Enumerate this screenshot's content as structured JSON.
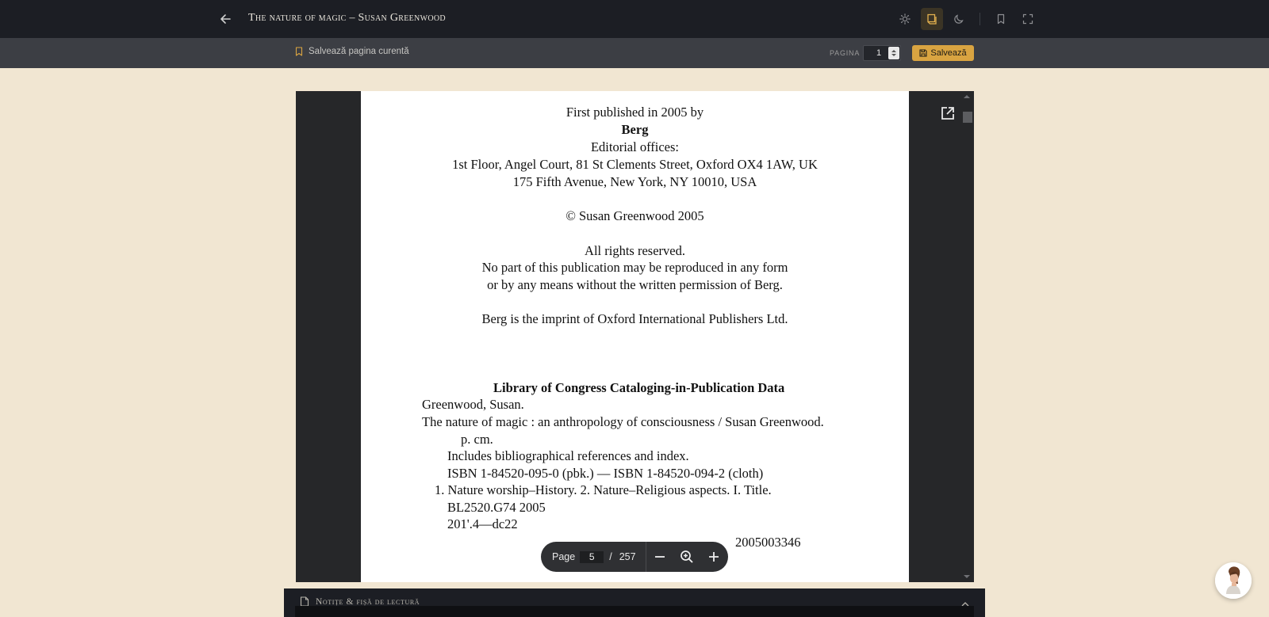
{
  "header": {
    "title": "The nature of magic – Susan Greenwood",
    "icons": [
      "arrow-left-icon",
      "sun-icon",
      "sepia-icon",
      "moon-icon",
      "bookmark-icon",
      "fullscreen-icon"
    ]
  },
  "savebar": {
    "save_current_label": "Salvează pagina curentă",
    "page_label": "PAGINA",
    "page_value": "1",
    "save_button_label": "Salvează"
  },
  "pdf": {
    "lines": {
      "l1": "First published in 2005 by",
      "l2": "Berg",
      "l3": "Editorial offices:",
      "l4": "1st Floor, Angel Court, 81 St Clements Street, Oxford OX4 1AW, UK",
      "l5": "175 Fifth Avenue, New York, NY 10010, USA",
      "l6": "© Susan Greenwood 2005",
      "l7": "All rights reserved.",
      "l8": "No part of this publication may be reproduced in any form",
      "l9": "or by any means without the written permission of Berg.",
      "l10": "Berg is the imprint of Oxford International Publishers Ltd.",
      "l11": "Library of Congress Cataloging-in-Publication Data",
      "l12": "Greenwood, Susan.",
      "l13": "The nature of magic : an anthropology of consciousness / Susan Greenwood.",
      "l14": "p. cm.",
      "l15": "Includes bibliographical references and index.",
      "l16": "ISBN 1-84520-095-0 (pbk.) — ISBN 1-84520-094-2 (cloth)",
      "l17": "1. Nature worship–History. 2. Nature–Religious aspects. I. Title.",
      "l18": "BL2520.G74 2005",
      "l19": "201'.4—dc22",
      "l20": "2005003346"
    }
  },
  "page_control": {
    "label": "Page",
    "current": "5",
    "separator": "/",
    "total": "257"
  },
  "notes": {
    "title": "Notițe & fișă de lectură"
  },
  "colors": {
    "accent": "#d9a441",
    "topbar": "#1c1e24",
    "background": "#f1e6d2"
  }
}
